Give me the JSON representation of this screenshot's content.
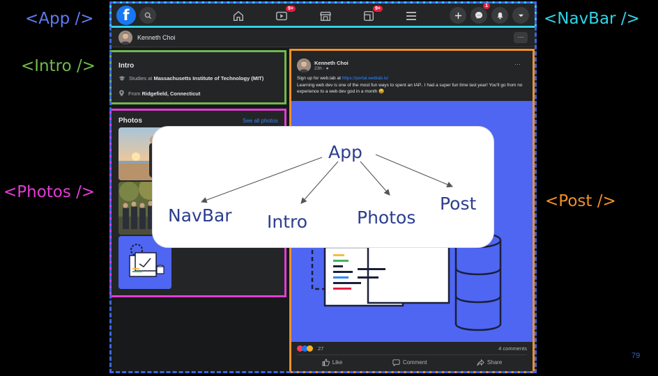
{
  "labels": {
    "app": "<App />",
    "navbar": "<NavBar />",
    "intro": "<Intro />",
    "photos": "<Photos />",
    "post": "<Post />"
  },
  "slide_number": "79",
  "navbar": {
    "logo": "f",
    "watch_badge": "9+",
    "groups_badge": "9+",
    "messenger_badge": "1",
    "icons": [
      "search-icon",
      "home-icon",
      "watch-icon",
      "marketplace-icon",
      "groups-icon",
      "menu-icon",
      "plus-icon",
      "messenger-icon",
      "bell-icon",
      "caret-down-icon"
    ]
  },
  "profile": {
    "name": "Kenneth Choi",
    "more": "···"
  },
  "intro": {
    "title": "Intro",
    "studies_prefix": "Studies at ",
    "studies_school": "Massachusetts Institute of Technology (MIT)",
    "from_prefix": "From ",
    "from_place": "Ridgefield, Connecticut"
  },
  "photos": {
    "title": "Photos",
    "see_all": "See all photos"
  },
  "post": {
    "author": "Kenneth Choi",
    "time": "23h · ",
    "more": "···",
    "text_prefix": "Sign up for web.lab at ",
    "link": "https://portal.weblab.is/",
    "text_body": "Learning web dev is one of the most fun ways to spent an IAP.. I had a super fun time last year! You'll go from no experience to a web dev god in a month 😄",
    "reactions_count": "27",
    "comments": "4 comments",
    "like": "Like",
    "comment": "Comment",
    "share": "Share"
  },
  "tree": {
    "root": "App",
    "children": [
      "NavBar",
      "Intro",
      "Photos",
      "Post"
    ]
  },
  "colors": {
    "app": "#3f67e0",
    "navbar": "#2fd3e8",
    "intro": "#72b94d",
    "photos": "#e43cd6",
    "post": "#f0912a",
    "fb_blue": "#1877f2",
    "image_blue": "#4e66f2"
  }
}
